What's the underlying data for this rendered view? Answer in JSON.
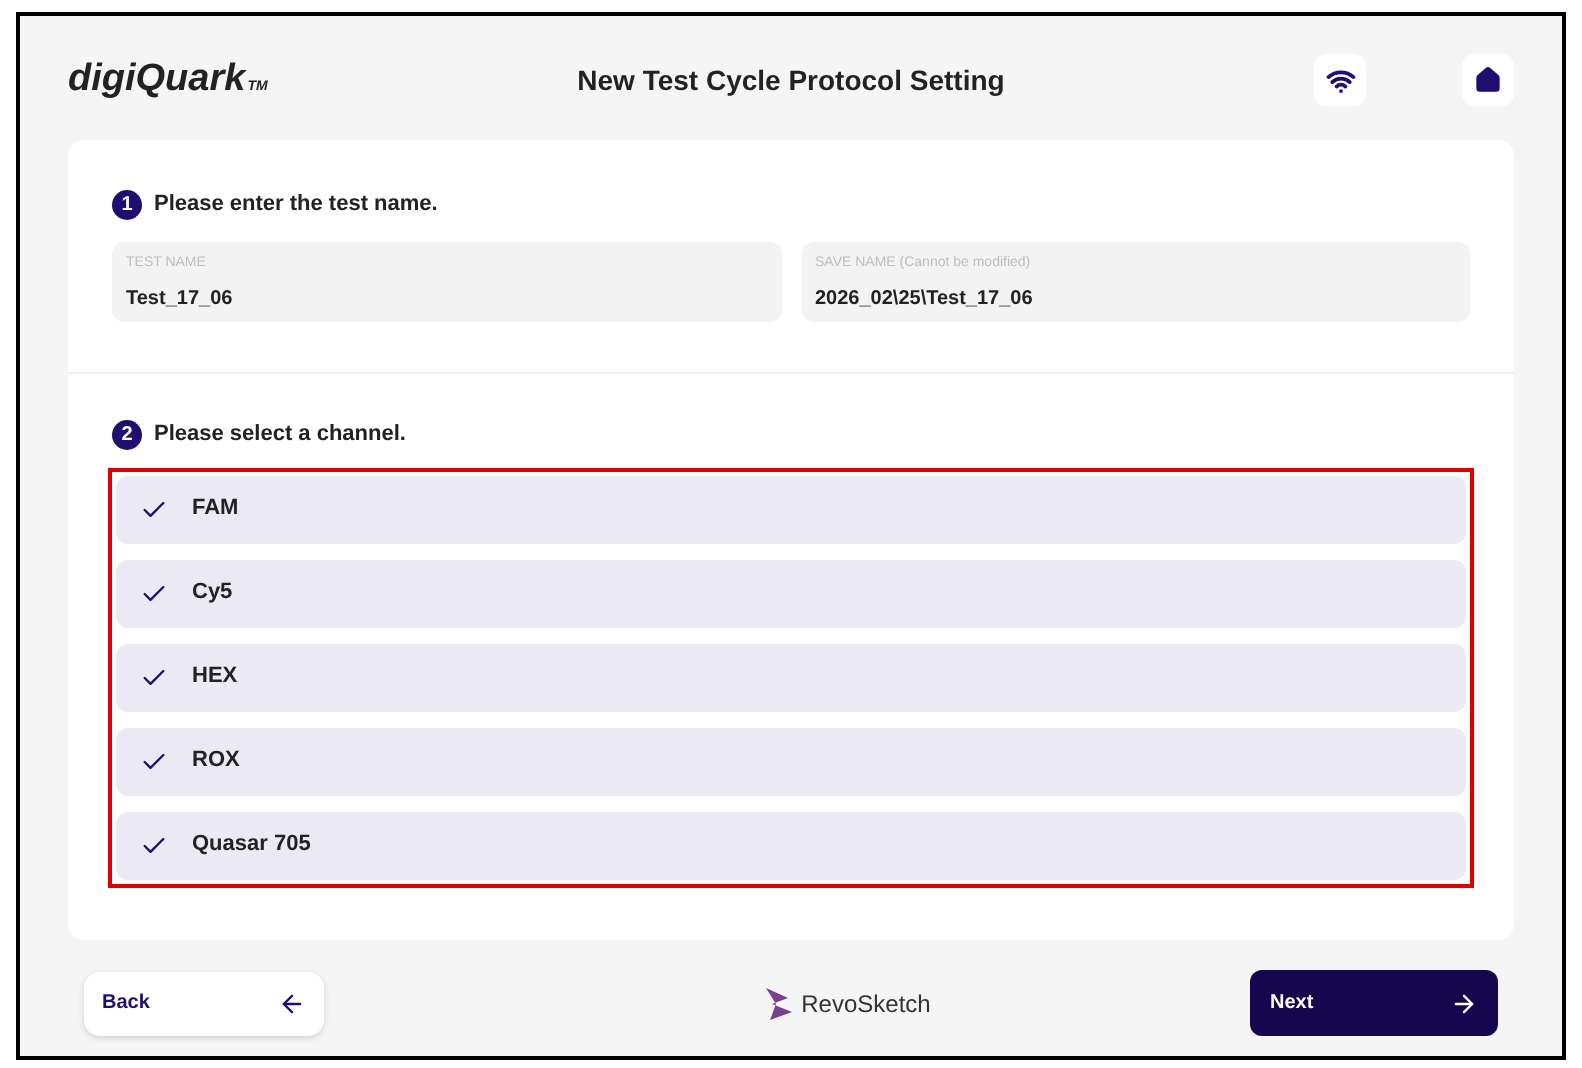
{
  "header": {
    "brand": "digiQuark",
    "trademark": "TM",
    "title": "New Test Cycle Protocol Setting"
  },
  "step1": {
    "number": "1",
    "heading": "Please enter the test name.",
    "fields": [
      {
        "label": "TEST NAME",
        "value": "Test_17_06"
      },
      {
        "label": "SAVE NAME (Cannot be modified)",
        "value": "2026_02\\25\\Test_17_06"
      }
    ]
  },
  "step2": {
    "number": "2",
    "heading": "Please select a channel.",
    "highlighted": true,
    "channels": [
      {
        "name": "FAM",
        "checked": true
      },
      {
        "name": "Cy5",
        "checked": true
      },
      {
        "name": "HEX",
        "checked": true
      },
      {
        "name": "ROX",
        "checked": true
      },
      {
        "name": "Quasar 705",
        "checked": true
      }
    ]
  },
  "footer": {
    "back": "Back",
    "logo": "RevoSketch",
    "next": "Next"
  }
}
